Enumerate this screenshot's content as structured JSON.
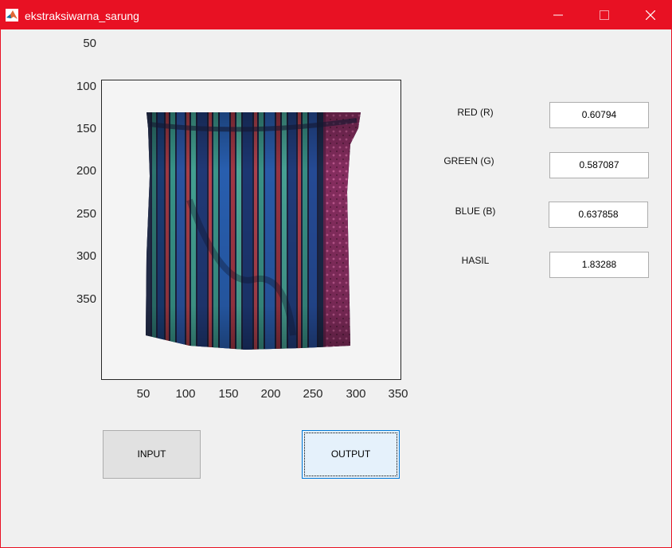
{
  "window": {
    "title": "ekstraksiwarna_sarung",
    "accent": "#e81123"
  },
  "titlebar_controls": [
    "minimize-icon",
    "maximize-icon",
    "close-icon"
  ],
  "axes": {
    "image": "sarung-photo",
    "y_ticks": [
      "50",
      "100",
      "150",
      "200",
      "250",
      "300",
      "350"
    ],
    "x_ticks": [
      "50",
      "100",
      "150",
      "200",
      "250",
      "300",
      "350"
    ]
  },
  "fields": {
    "red": {
      "label": "RED (R)",
      "value": "0.60794"
    },
    "green": {
      "label": "GREEN (G)",
      "value": "0.587087"
    },
    "blue": {
      "label": "BLUE (B)",
      "value": "0.637858"
    },
    "hasil": {
      "label": "HASIL",
      "value": "1.83288"
    }
  },
  "buttons": {
    "input": "INPUT",
    "output": "OUTPUT"
  }
}
